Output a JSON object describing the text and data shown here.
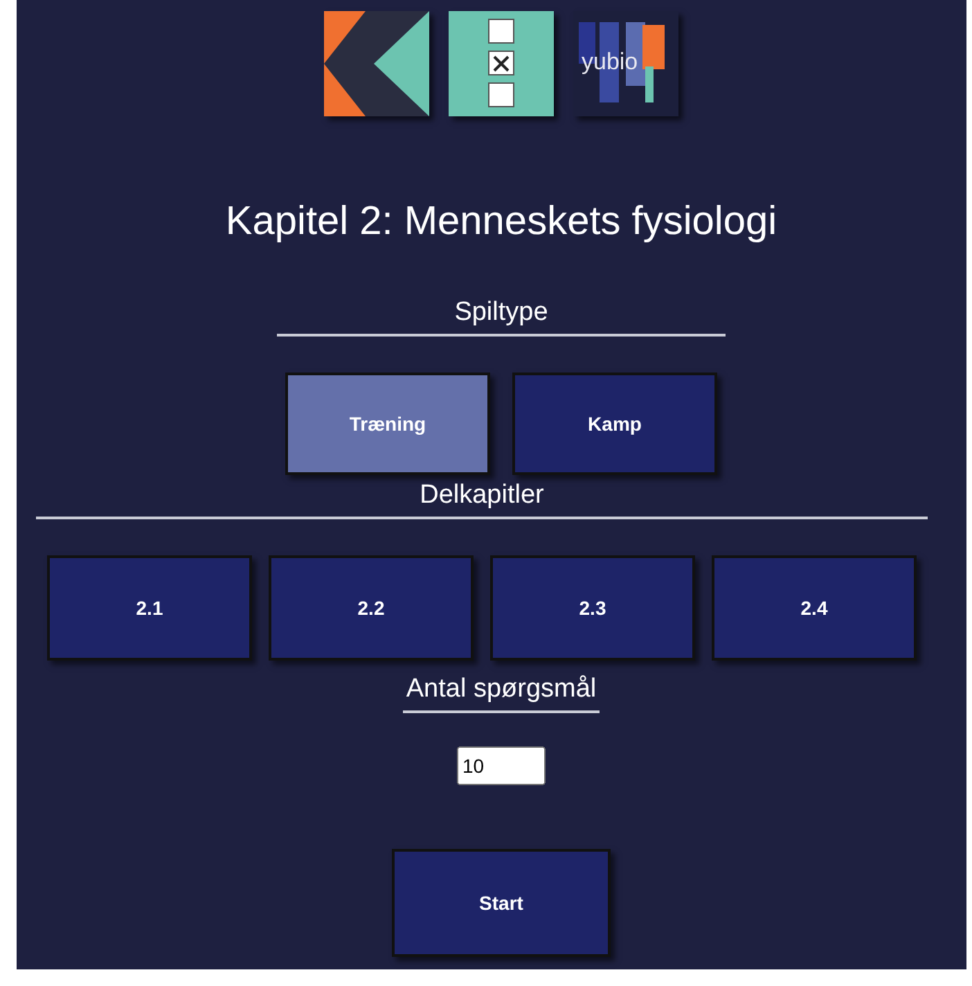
{
  "logos": [
    {
      "kind": "chevron"
    },
    {
      "kind": "checklist"
    },
    {
      "kind": "yubio",
      "text": "yubio"
    }
  ],
  "title": "Kapitel 2: Menneskets fysiologi",
  "game_type": {
    "heading": "Spiltype",
    "options": [
      {
        "label": "Træning",
        "selected": true
      },
      {
        "label": "Kamp",
        "selected": false
      }
    ]
  },
  "subchapters": {
    "heading": "Delkapitler",
    "options": [
      {
        "label": "2.1",
        "selected": false
      },
      {
        "label": "2.2",
        "selected": false
      },
      {
        "label": "2.3",
        "selected": false
      },
      {
        "label": "2.4",
        "selected": false
      }
    ]
  },
  "question_count": {
    "heading": "Antal spørgsmål",
    "value": "10"
  },
  "start_button": "Start"
}
